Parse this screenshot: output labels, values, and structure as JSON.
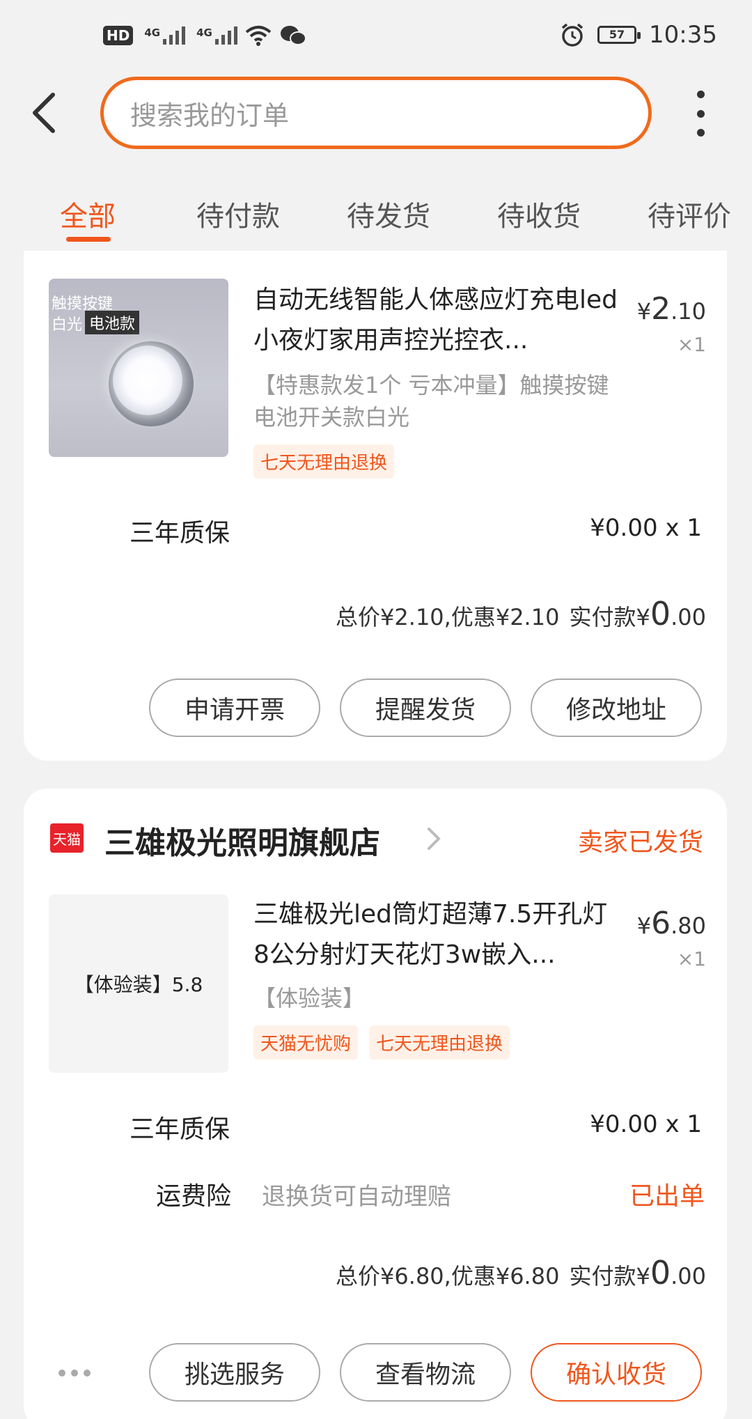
{
  "status_bar": {
    "hd": "HD",
    "signal_a": "4G",
    "signal_b": "4G",
    "battery": "57",
    "time": "10:35"
  },
  "header": {
    "search_placeholder": "搜索我的订单"
  },
  "tabs": [
    {
      "label": "全部",
      "active": true
    },
    {
      "label": "待付款"
    },
    {
      "label": "待发货"
    },
    {
      "label": "待收货"
    },
    {
      "label": "待评价"
    }
  ],
  "orders": [
    {
      "thumb_text": {
        "top": "触摸按键",
        "left": "白光",
        "right": "电池款"
      },
      "title": "自动无线智能人体感应灯充电led小夜灯家用声控光控衣...",
      "sku": "【特惠款发1个 亏本冲量】触摸按键电池开关款白光",
      "price_symbol": "¥",
      "price_int": "2",
      "price_dec": ".10",
      "qty": "×1",
      "tags": [
        "七天无理由退换"
      ],
      "service": {
        "label": "三年质保",
        "value": "¥0.00 x 1"
      },
      "total": {
        "summary": "总价¥2.10,优惠¥2.10",
        "paid_label": "实付款",
        "symbol": "¥",
        "int": "0",
        "dec": ".00"
      },
      "buttons": [
        "申请开票",
        "提醒发货",
        "修改地址"
      ]
    },
    {
      "shop": {
        "icon": "天猫",
        "name": "三雄极光照明旗舰店",
        "status": "卖家已发货"
      },
      "thumb_text": "【体验装】5.8",
      "title": "三雄极光led筒灯超薄7.5开孔灯8公分射灯天花灯3w嵌入...",
      "sku": "【体验装】",
      "price_symbol": "¥",
      "price_int": "6",
      "price_dec": ".80",
      "qty": "×1",
      "tags": [
        "天猫无忧购",
        "七天无理由退换"
      ],
      "service": {
        "label": "三年质保",
        "value": "¥0.00 x 1"
      },
      "insurance": {
        "label": "运费险",
        "desc": "退换货可自动理赔",
        "status": "已出单"
      },
      "total": {
        "summary": "总价¥6.80,优惠¥6.80",
        "paid_label": "实付款",
        "symbol": "¥",
        "int": "0",
        "dec": ".00"
      },
      "buttons": [
        "挑选服务",
        "查看物流",
        "确认收货"
      ]
    }
  ],
  "colors": {
    "accent": "#f0561c",
    "tmall": "#e8222a"
  }
}
